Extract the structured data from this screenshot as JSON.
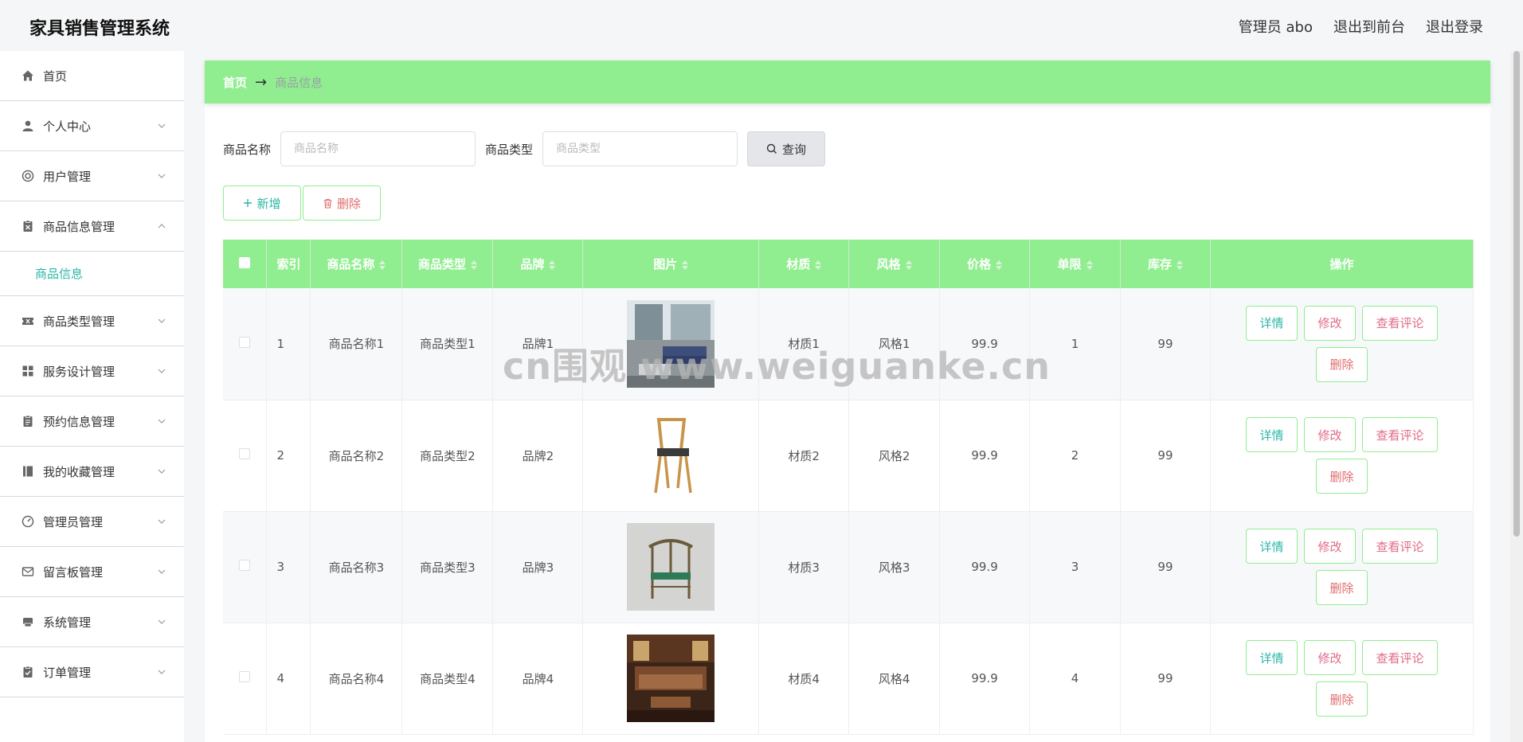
{
  "header": {
    "app_title": "家具销售管理系统",
    "admin_label": "管理员 abo",
    "back_to_front": "退出到前台",
    "logout": "退出登录"
  },
  "sidebar": {
    "items": [
      {
        "label": "首页",
        "icon": "home-icon"
      },
      {
        "label": "个人中心",
        "icon": "user-icon"
      },
      {
        "label": "用户管理",
        "icon": "lifebuoy-icon"
      },
      {
        "label": "商品信息管理",
        "icon": "clipboard-x-icon",
        "expanded": true
      },
      {
        "label": "商品类型管理",
        "icon": "tickets-icon"
      },
      {
        "label": "服务设计管理",
        "icon": "grid-icon"
      },
      {
        "label": "预约信息管理",
        "icon": "clipboard-icon"
      },
      {
        "label": "我的收藏管理",
        "icon": "book-icon"
      },
      {
        "label": "管理员管理",
        "icon": "gauge-icon"
      },
      {
        "label": "留言板管理",
        "icon": "message-icon"
      },
      {
        "label": "系统管理",
        "icon": "printer-icon"
      },
      {
        "label": "订单管理",
        "icon": "clipboard-check-icon"
      }
    ],
    "submenu_active": "商品信息"
  },
  "breadcrumb": {
    "home": "首页",
    "arrow": "→",
    "current": "商品信息"
  },
  "search": {
    "name_label": "商品名称",
    "name_placeholder": "商品名称",
    "type_label": "商品类型",
    "type_placeholder": "商品类型",
    "button": "查询"
  },
  "actions": {
    "add": "新增",
    "delete": "删除"
  },
  "table": {
    "columns": [
      "索引",
      "商品名称",
      "商品类型",
      "品牌",
      "图片",
      "材质",
      "风格",
      "价格",
      "单限",
      "库存",
      "操作"
    ],
    "rows": [
      {
        "index": "1",
        "name": "商品名称1",
        "type": "商品类型1",
        "brand": "品牌1",
        "material": "材质1",
        "style": "风格1",
        "price": "99.9",
        "limit": "1",
        "stock": "99"
      },
      {
        "index": "2",
        "name": "商品名称2",
        "type": "商品类型2",
        "brand": "品牌2",
        "material": "材质2",
        "style": "风格2",
        "price": "99.9",
        "limit": "2",
        "stock": "99"
      },
      {
        "index": "3",
        "name": "商品名称3",
        "type": "商品类型3",
        "brand": "品牌3",
        "material": "材质3",
        "style": "风格3",
        "price": "99.9",
        "limit": "3",
        "stock": "99"
      },
      {
        "index": "4",
        "name": "商品名称4",
        "type": "商品类型4",
        "brand": "品牌4",
        "material": "材质4",
        "style": "风格4",
        "price": "99.9",
        "limit": "4",
        "stock": "99"
      }
    ],
    "ops": {
      "detail": "详情",
      "edit": "修改",
      "comments": "查看评论",
      "remove": "删除"
    }
  },
  "watermark": "cn围观  www.weiguanke.cn",
  "colors": {
    "accent_green": "#90ee90",
    "teal": "#2bb6a7",
    "pink": "#e06b8a",
    "red": "#e06b6b"
  }
}
